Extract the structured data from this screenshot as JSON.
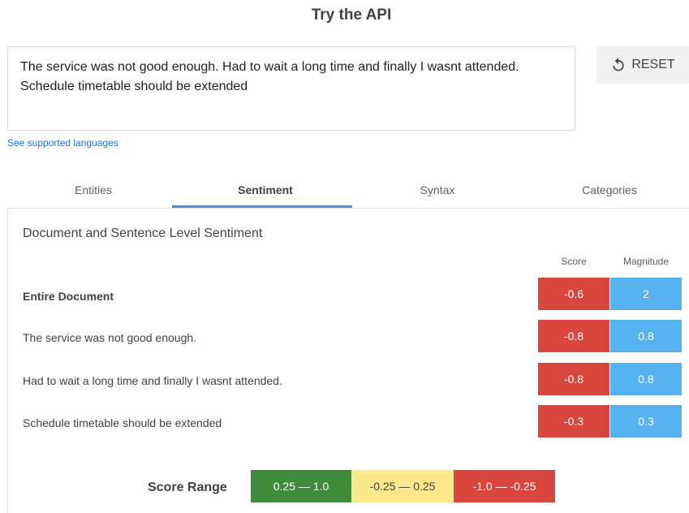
{
  "title": "Try the API",
  "input": {
    "text": "The service was not good enough. Had to wait a long time and finally I wasnt attended. Schedule timetable should be extended"
  },
  "reset_label": "RESET",
  "supported_link": "See supported languages",
  "tabs": [
    {
      "label": "Entities"
    },
    {
      "label": "Sentiment"
    },
    {
      "label": "Syntax"
    },
    {
      "label": "Categories"
    }
  ],
  "active_tab": "Sentiment",
  "sentiment": {
    "heading": "Document and Sentence Level Sentiment",
    "score_header": "Score",
    "magnitude_header": "Magnitude",
    "rows": [
      {
        "label": "Entire Document",
        "score": "-0.6",
        "magnitude": "2"
      },
      {
        "label": "The service was not good enough.",
        "score": "-0.8",
        "magnitude": "0.8"
      },
      {
        "label": "Had to wait a long time and finally I wasnt attended.",
        "score": "-0.8",
        "magnitude": "0.8"
      },
      {
        "label": "Schedule timetable should be extended",
        "score": "-0.3",
        "magnitude": "0.3"
      }
    ]
  },
  "score_range": {
    "label": "Score Range",
    "positive": "0.25 — 1.0",
    "neutral": "-0.25 — 0.25",
    "negative": "-1.0 — -0.25"
  },
  "colors": {
    "negative": "#d8463d",
    "magnitude": "#56b3f0",
    "positive": "#3f8a3b",
    "neutral": "#fde88c",
    "accent": "#4a90e2"
  },
  "icons": {
    "reset": "reset-icon"
  }
}
